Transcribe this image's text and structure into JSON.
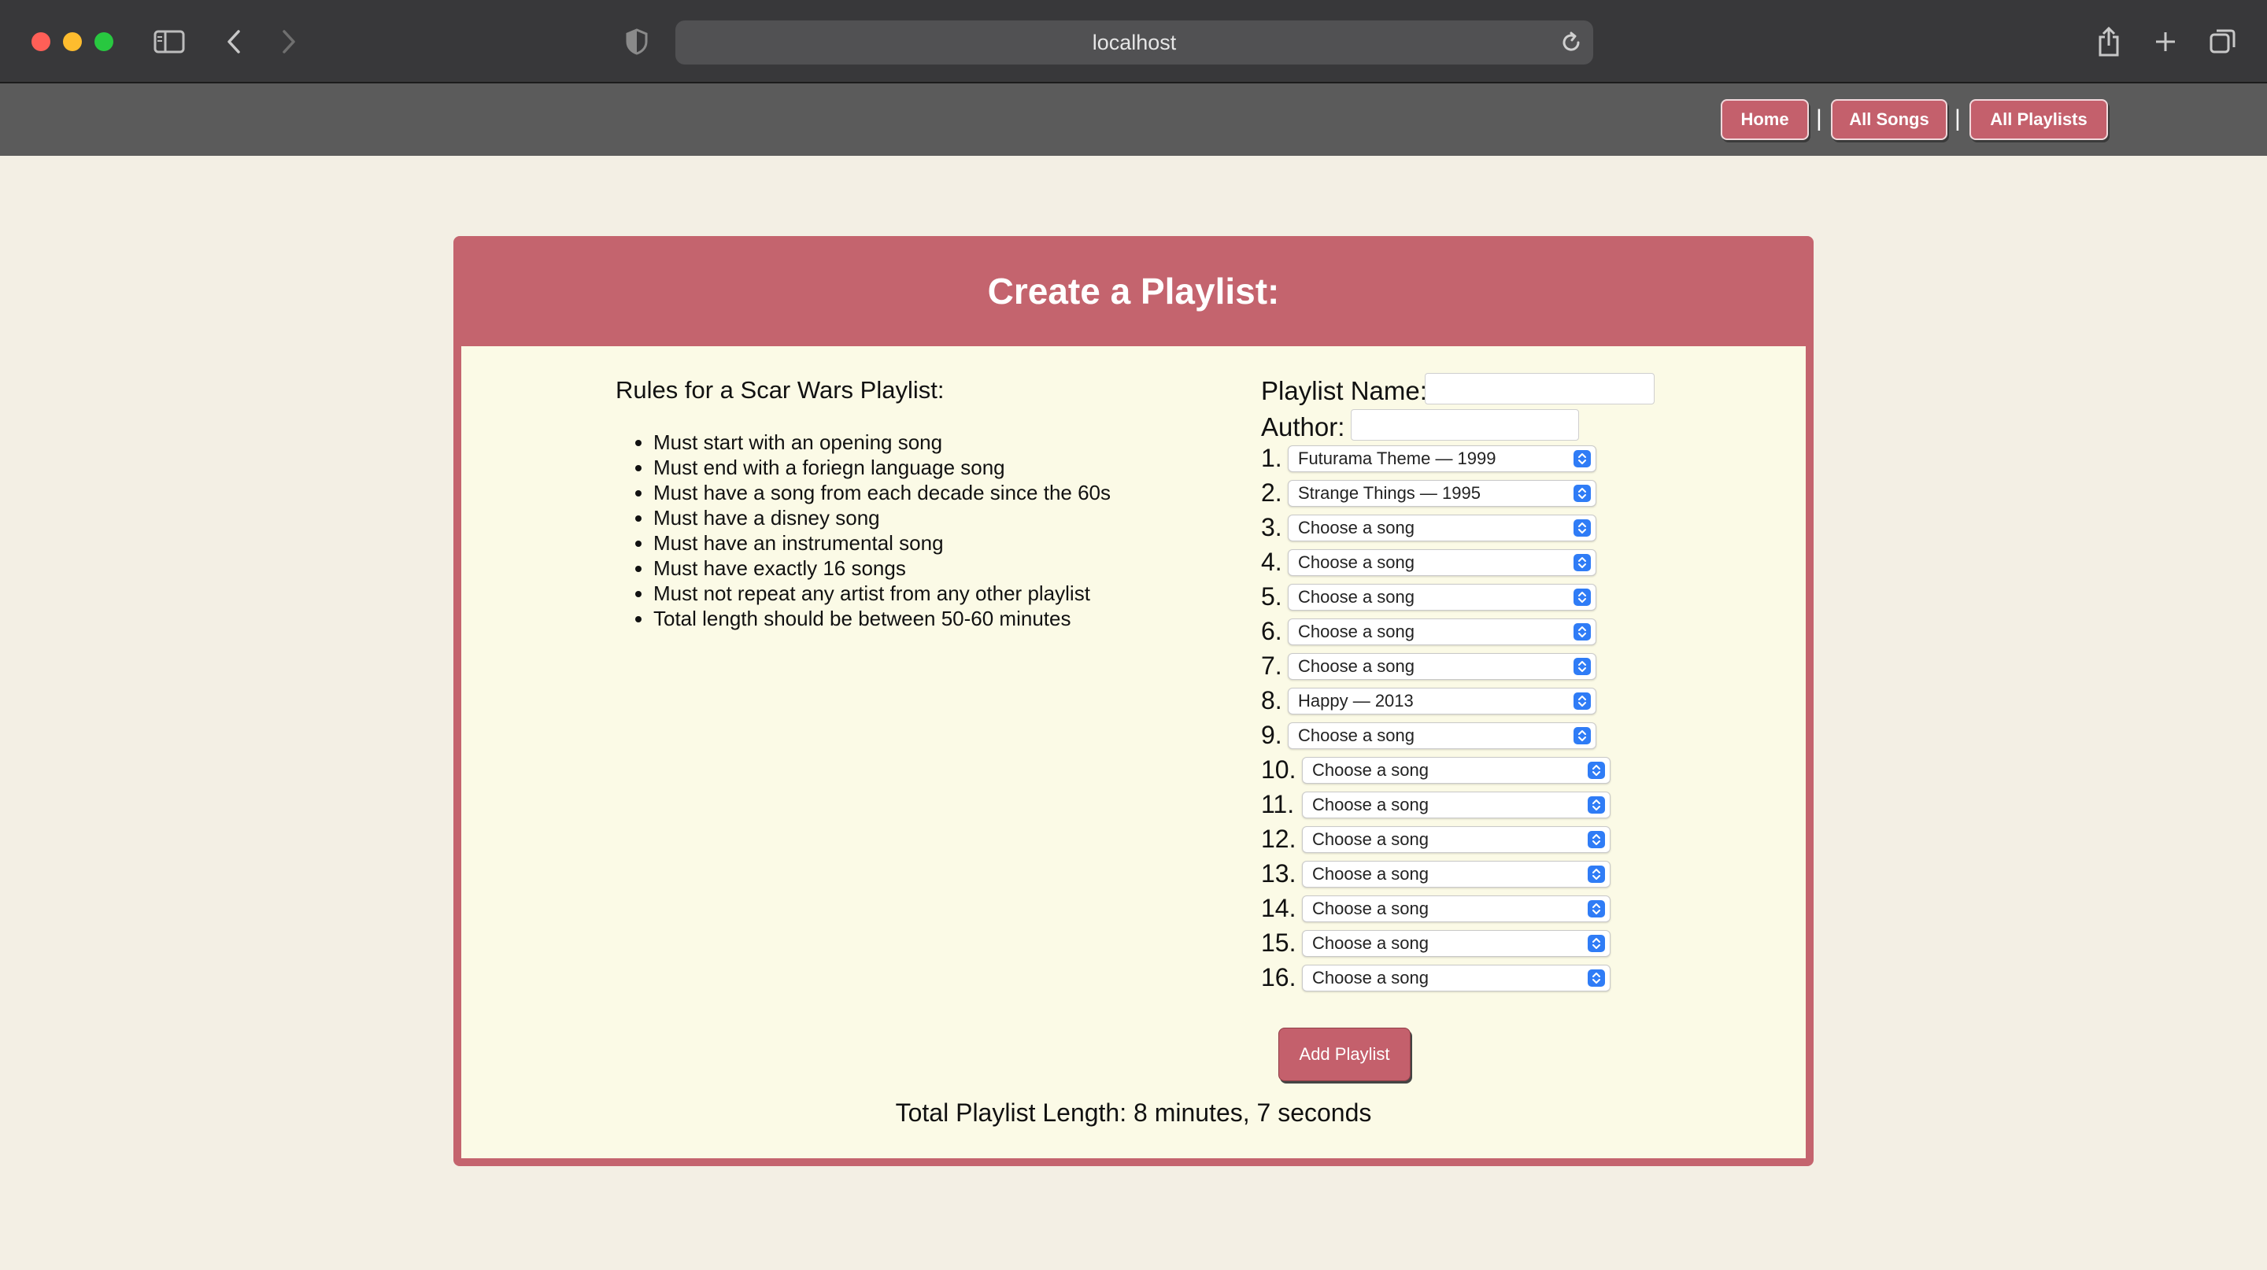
{
  "browser": {
    "url": "localhost"
  },
  "nav": {
    "home": "Home",
    "all_songs": "All Songs",
    "all_playlists": "All Playlists",
    "separator": "|"
  },
  "card": {
    "title": "Create a Playlist:"
  },
  "rules": {
    "title": "Rules for a Scar Wars Playlist:",
    "items": [
      "Must start with an opening song",
      "Must end with a foriegn language song",
      "Must have a song from each decade since the 60s",
      "Must have a disney song",
      "Must have an instrumental song",
      "Must have exactly 16 songs",
      "Must not repeat any artist from any other playlist",
      "Total length should be between 50-60 minutes"
    ]
  },
  "form": {
    "playlist_name_label": "Playlist Name:",
    "playlist_name_value": "",
    "author_label": "Author:",
    "author_value": "",
    "songs": [
      {
        "num": "1.",
        "value": "Futurama Theme — 1999"
      },
      {
        "num": "2.",
        "value": "Strange Things — 1995"
      },
      {
        "num": "3.",
        "value": "Choose a song"
      },
      {
        "num": "4.",
        "value": "Choose a song"
      },
      {
        "num": "5.",
        "value": "Choose a song"
      },
      {
        "num": "6.",
        "value": "Choose a song"
      },
      {
        "num": "7.",
        "value": "Choose a song"
      },
      {
        "num": "8.",
        "value": "Happy — 2013"
      },
      {
        "num": "9.",
        "value": "Choose a song"
      },
      {
        "num": "10.",
        "value": "Choose a song"
      },
      {
        "num": "11.",
        "value": "Choose a song"
      },
      {
        "num": "12.",
        "value": "Choose a song"
      },
      {
        "num": "13.",
        "value": "Choose a song"
      },
      {
        "num": "14.",
        "value": "Choose a song"
      },
      {
        "num": "15.",
        "value": "Choose a song"
      },
      {
        "num": "16.",
        "value": "Choose a song"
      }
    ],
    "add_button": "Add Playlist"
  },
  "total_length": "Total Playlist Length: 8 minutes, 7 seconds",
  "colors": {
    "accent": "#c4646e",
    "card_background": "#fbfae6",
    "page_background": "#f3efe4",
    "navbar": "#5b5b5b",
    "select_chevron": "#2f7cf6"
  }
}
